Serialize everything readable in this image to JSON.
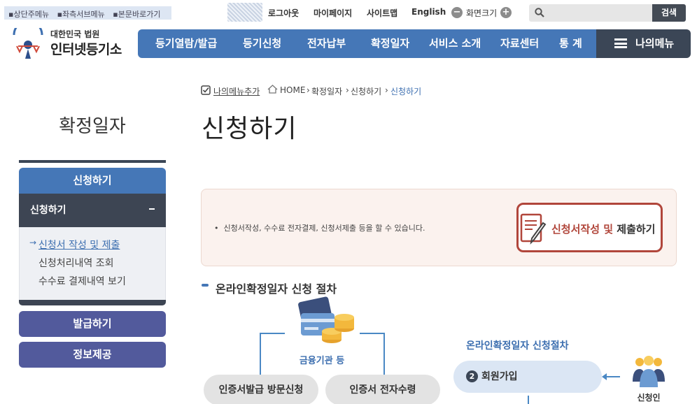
{
  "skip_links": [
    "상단주메뉴",
    "좌측서브메뉴",
    "본문바로가기"
  ],
  "util_menu": {
    "logout": "로그아웃",
    "mypage": "마이페이지",
    "sitemap": "사이트맵",
    "english": "English",
    "zoom_label": "화면크기",
    "zoom_out": "−",
    "zoom_in": "+"
  },
  "search": {
    "placeholder": "",
    "button": "검색"
  },
  "logo": {
    "small": "대한민국 법원",
    "big": "인터넷등기소"
  },
  "nav": {
    "items": [
      "등기열람/발급",
      "등기신청",
      "전자납부",
      "확정일자",
      "서비스 소개",
      "자료센터",
      "통 계"
    ],
    "my_menu": "나의메뉴"
  },
  "breadcrumb": {
    "add_menu": "나의메뉴추가",
    "home": "HOME",
    "path": [
      "확정일자",
      "신청하기",
      "신청하기"
    ]
  },
  "sidebar": {
    "title": "확정일자",
    "section": "신청하기",
    "sub_section": "신청하기",
    "items": [
      "신청서 작성 및 제출",
      "신청처리내역 조회",
      "수수료 결제내역 보기"
    ],
    "active_index": 0,
    "buttons": [
      "발급하기",
      "정보제공"
    ]
  },
  "page": {
    "title": "신청하기",
    "info_text": "신청서작성, 수수료 전자결제, 신청서제출 등을 할 수 있습니다.",
    "cta_red": "신청서작성 및",
    "cta_dark": "제출하기",
    "section_heading": "온라인확정일자 신청 절차"
  },
  "diagram": {
    "bank_label": "금융기관 등",
    "pill_left": "인증서발급 방문신청",
    "pill_right": "인증서 전자수령",
    "process_title": "온라인확정일자 신청절차",
    "step_number": "2",
    "step_label": "회원가입",
    "person_label": "신청인"
  },
  "colors": {
    "nav_blue": "#4577b7",
    "nav_dark": "#3b4656",
    "side_purple": "#525a9c",
    "cta_red": "#b1463b"
  }
}
